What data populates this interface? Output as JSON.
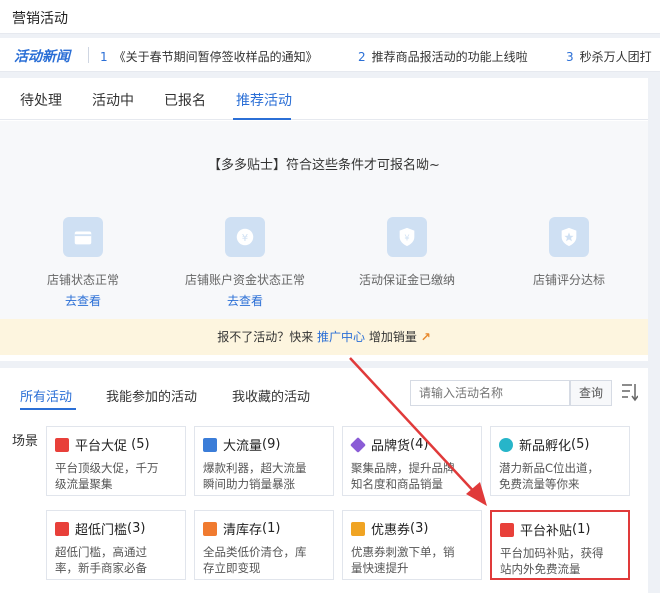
{
  "header": {
    "title": "营销活动"
  },
  "news": {
    "brand": "活动新闻",
    "items": [
      {
        "num": "1",
        "text": "《关于春节期间暂停签收样品的通知》"
      },
      {
        "num": "2",
        "text": "推荐商品报活动的功能上线啦"
      },
      {
        "num": "3",
        "text": "秒杀万人团打"
      }
    ]
  },
  "tabs": [
    "待处理",
    "活动中",
    "已报名",
    "推荐活动"
  ],
  "tips": {
    "title": "【多多贴士】符合这些条件才可报名呦~",
    "conditions": [
      {
        "icon": "store-icon",
        "label": "店铺状态正常",
        "link": "去查看"
      },
      {
        "icon": "yen-icon",
        "label": "店铺账户资金状态正常",
        "link": "去查看"
      },
      {
        "icon": "shield-yen-icon",
        "label": "活动保证金已缴纳",
        "link": ""
      },
      {
        "icon": "star-badge-icon",
        "label": "店铺评分达标",
        "link": ""
      }
    ],
    "promo_prefix": "报不了活动？快来",
    "promo_link": "推广中心",
    "promo_suffix": "增加销量"
  },
  "activities": {
    "filters": [
      "所有活动",
      "我能参加的活动",
      "我收藏的活动"
    ],
    "search_placeholder": "请输入活动名称",
    "query_button": "查询",
    "scene_label": "场景",
    "cards": [
      {
        "title": "平台大促",
        "count": "(5)",
        "desc1": "平台顶级大促，千万",
        "desc2": "级流量聚集",
        "color": "#e8403a"
      },
      {
        "title": "大流量",
        "count": "(9)",
        "desc1": "爆款利器，超大流量",
        "desc2": "瞬间助力销量暴涨",
        "color": "#3b7dd8"
      },
      {
        "title": "品牌货",
        "count": "(4)",
        "desc1": "聚集品牌，提升品牌",
        "desc2": "知名度和商品销量",
        "color": "#8a5cd6"
      },
      {
        "title": "新品孵化",
        "count": "(5)",
        "desc1": "潜力新品C位出道，",
        "desc2": "免费流量等你来",
        "color": "#27b5c9"
      },
      {
        "title": "超低门槛",
        "count": "(3)",
        "desc1": "超低门槛，高通过",
        "desc2": "率，新手商家必备",
        "color": "#e8403a"
      },
      {
        "title": "清库存",
        "count": "(1)",
        "desc1": "全品类低价清仓，库",
        "desc2": "存立即变现",
        "color": "#f07a2f"
      },
      {
        "title": "优惠券",
        "count": "(3)",
        "desc1": "优惠券刺激下单，销",
        "desc2": "量快速提升",
        "color": "#f0a423"
      },
      {
        "title": "平台补贴",
        "count": "(1)",
        "desc1": "平台加码补贴，获得",
        "desc2": "站内外免费流量",
        "color": "#e8403a"
      }
    ]
  },
  "colors": {
    "accent": "#2b6fd6",
    "highlight": "#e03a3a"
  }
}
